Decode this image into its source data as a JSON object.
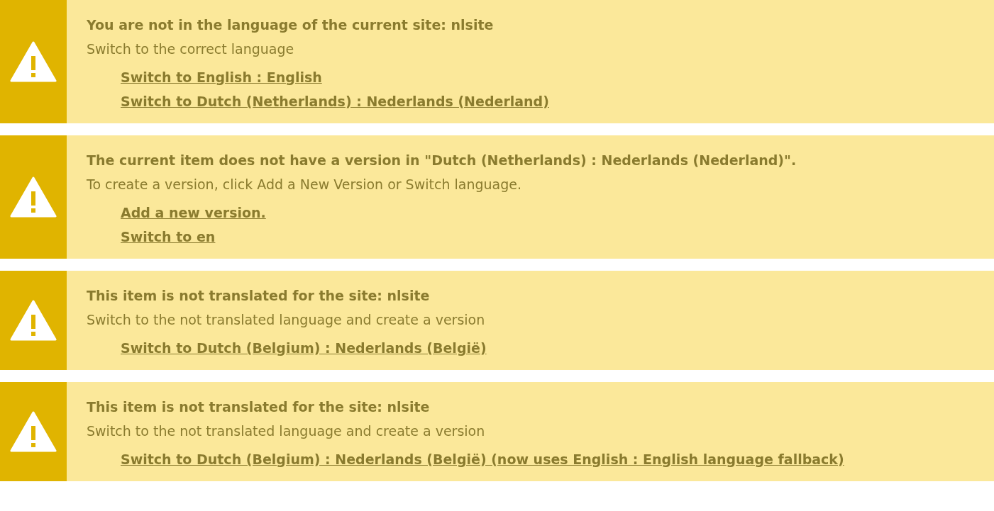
{
  "messages": [
    {
      "title": "You are not in the language of the current site: nlsite",
      "description": "Switch to the correct language",
      "links": [
        "Switch to English : English",
        "Switch to Dutch (Netherlands) : Nederlands (Nederland)"
      ]
    },
    {
      "title": "The current item does not have a version in \"Dutch (Netherlands) : Nederlands (Nederland)\".",
      "description": "To create a version, click Add a New Version or Switch language.",
      "links": [
        "Add a new version.",
        "Switch to en"
      ]
    },
    {
      "title": "This item is not translated for the site: nlsite",
      "description": "Switch to the not translated language and create a version",
      "links": [
        "Switch to Dutch (Belgium) : Nederlands (België)"
      ]
    },
    {
      "title": "This item is not translated for the site: nlsite",
      "description": "Switch to the not translated language and create a version",
      "links": [
        "Switch to Dutch (Belgium) : Nederlands (België) (now uses English : English language fallback)"
      ]
    }
  ]
}
